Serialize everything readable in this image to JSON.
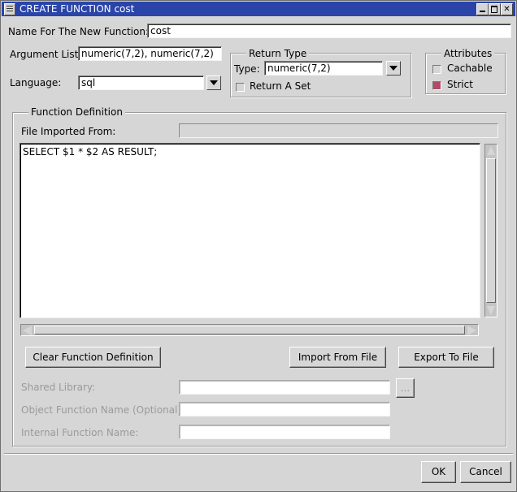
{
  "window": {
    "title": "CREATE FUNCTION cost"
  },
  "form": {
    "name_label": "Name For The New Function:",
    "name_value": "cost",
    "args_label": "Argument List:",
    "args_value": "numeric(7,2), numeric(7,2)",
    "language_label": "Language:",
    "language_value": "sql"
  },
  "return_type": {
    "group_title": "Return Type",
    "type_label": "Type:",
    "type_value": "numeric(7,2)",
    "return_set_label": "Return A Set",
    "return_set_checked": false
  },
  "attributes": {
    "group_title": "Attributes",
    "cachable_label": "Cachable",
    "cachable_checked": false,
    "strict_label": "Strict",
    "strict_checked": true
  },
  "definition": {
    "group_title": "Function Definition",
    "file_label": "File Imported From:",
    "file_value": "",
    "body": "SELECT $1 * $2 AS RESULT;",
    "clear_button": "Clear Function Definition",
    "import_button": "Import From File",
    "export_button": "Export To File"
  },
  "external": {
    "shared_library_label": "Shared Library:",
    "shared_library_value": "",
    "browse_button": "...",
    "object_name_label": "Object Function Name (Optional):",
    "object_name_value": "",
    "internal_name_label": "Internal Function Name:",
    "internal_name_value": ""
  },
  "footer": {
    "ok_button": "OK",
    "cancel_button": "Cancel"
  },
  "colors": {
    "titlebar": "#2a44a8",
    "background": "#d6d6d6",
    "checked": "#b04a66"
  }
}
